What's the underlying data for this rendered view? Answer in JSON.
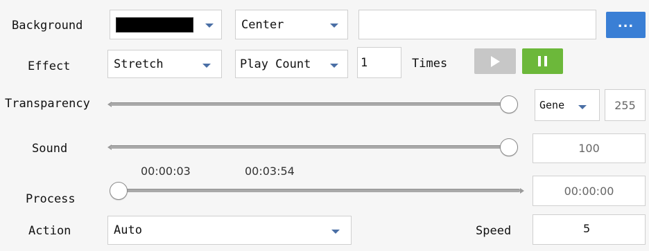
{
  "labels": {
    "background": "Background",
    "effect": "Effect",
    "transparency": "Transparency",
    "sound": "Sound",
    "process": "Process",
    "action": "Action",
    "times": "Times",
    "speed": "Speed"
  },
  "background": {
    "color_value": "#000000",
    "align_value": "Center",
    "path_value": "",
    "browse_label": "..."
  },
  "effect": {
    "mode_value": "Stretch",
    "play_mode_value": "Play Count",
    "count_value": "1"
  },
  "transparency": {
    "level": 1.0,
    "mode_value": "Gene",
    "value": "255"
  },
  "sound": {
    "level": 1.0,
    "value": "100"
  },
  "process": {
    "level": 0.0,
    "current_time": "00:00:03",
    "total_time": "00:03:54",
    "position_value": "00:00:00"
  },
  "action": {
    "value": "Auto",
    "speed_value": "5"
  },
  "colors": {
    "accent_blue": "#3a7fd5",
    "play_green": "#6cb83a",
    "play_gray": "#c7c7c7"
  },
  "icons": {
    "play": "play-icon",
    "pause": "pause-icon",
    "dropdown": "chevron-down-icon"
  }
}
